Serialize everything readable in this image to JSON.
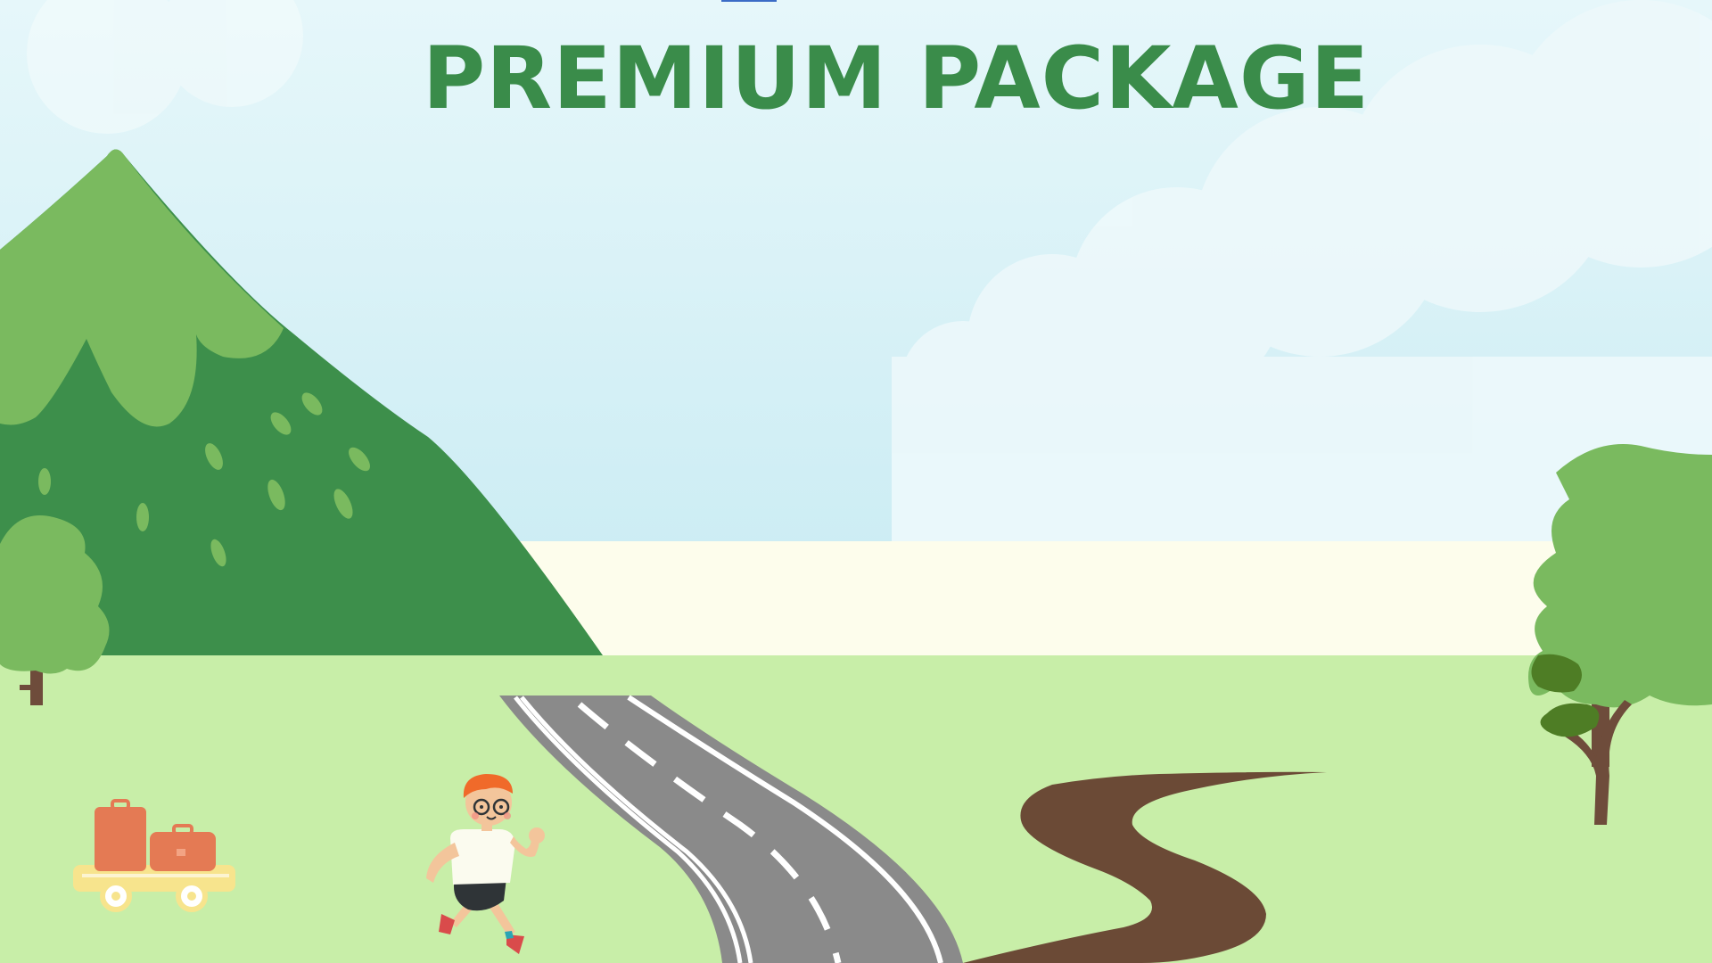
{
  "title": {
    "text": "PREMIUM PACKAGE",
    "color": "#3a8c4a"
  },
  "colors": {
    "sky_top": "#e3f6fa",
    "sky_bottom": "#cfeef5",
    "horizon_band": "#fdfdec",
    "grass": "#c8eea8",
    "mountain_dark": "#3d8f4b",
    "mountain_light": "#7aba5f",
    "road": "#8a8a8a",
    "road_lines": "#ffffff",
    "dirt_path": "#6b4a36",
    "tree_light": "#7aba5f",
    "tree_dark": "#4e7d25",
    "trunk": "#6e4c3b",
    "suitcase": "#e47a54",
    "cart": "#f7e48d"
  },
  "icons": {
    "mountain": "mountain-icon",
    "road": "road-icon",
    "dirt_path": "dirt-path-icon",
    "runner": "running-boy-icon",
    "luggage_cart": "luggage-cart-icon",
    "tree": "tree-icon",
    "clouds": "cloud-icon"
  }
}
